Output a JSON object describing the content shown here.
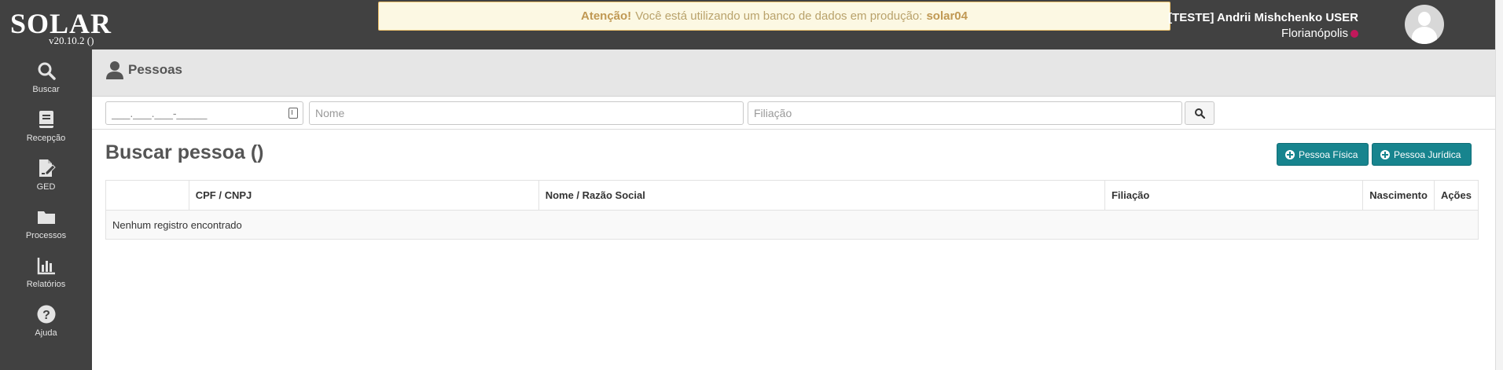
{
  "app": {
    "logo": "SOLAR",
    "version": "v20.10.2 ()"
  },
  "alert": {
    "strong": "Atenção!",
    "message": "Você está utilizando um banco de dados em produção:",
    "db": "solar04"
  },
  "user": {
    "name": "[TESTE] Andrii Mishchenko USER",
    "city": "Florianópolis",
    "city_dot_color": "#c2185b"
  },
  "sidebar": {
    "items": [
      {
        "label": "Buscar",
        "icon": "search-icon"
      },
      {
        "label": "Recepção",
        "icon": "book-icon"
      },
      {
        "label": "GED",
        "icon": "file-edit-icon"
      },
      {
        "label": "Processos",
        "icon": "folder-icon"
      },
      {
        "label": "Relatórios",
        "icon": "bar-chart-icon"
      },
      {
        "label": "Ajuda",
        "icon": "help-icon"
      }
    ]
  },
  "header": {
    "title": "Pessoas"
  },
  "filters": {
    "cpf_value": "___.___.___-_____",
    "nome_placeholder": "Nome",
    "filiacao_placeholder": "Filiação"
  },
  "content": {
    "title": "Buscar pessoa ()",
    "btn_pessoa_fisica": "Pessoa Física",
    "btn_pessoa_juridica": "Pessoa Jurídica"
  },
  "table": {
    "headers": [
      "",
      "CPF / CNPJ",
      "Nome / Razão Social",
      "Filiação",
      "Nascimento",
      "Ações"
    ],
    "empty_message": "Nenhum registro encontrado"
  },
  "colors": {
    "topbar": "#414141",
    "accent": "#17848e",
    "alert_bg": "#fcf8e3"
  }
}
